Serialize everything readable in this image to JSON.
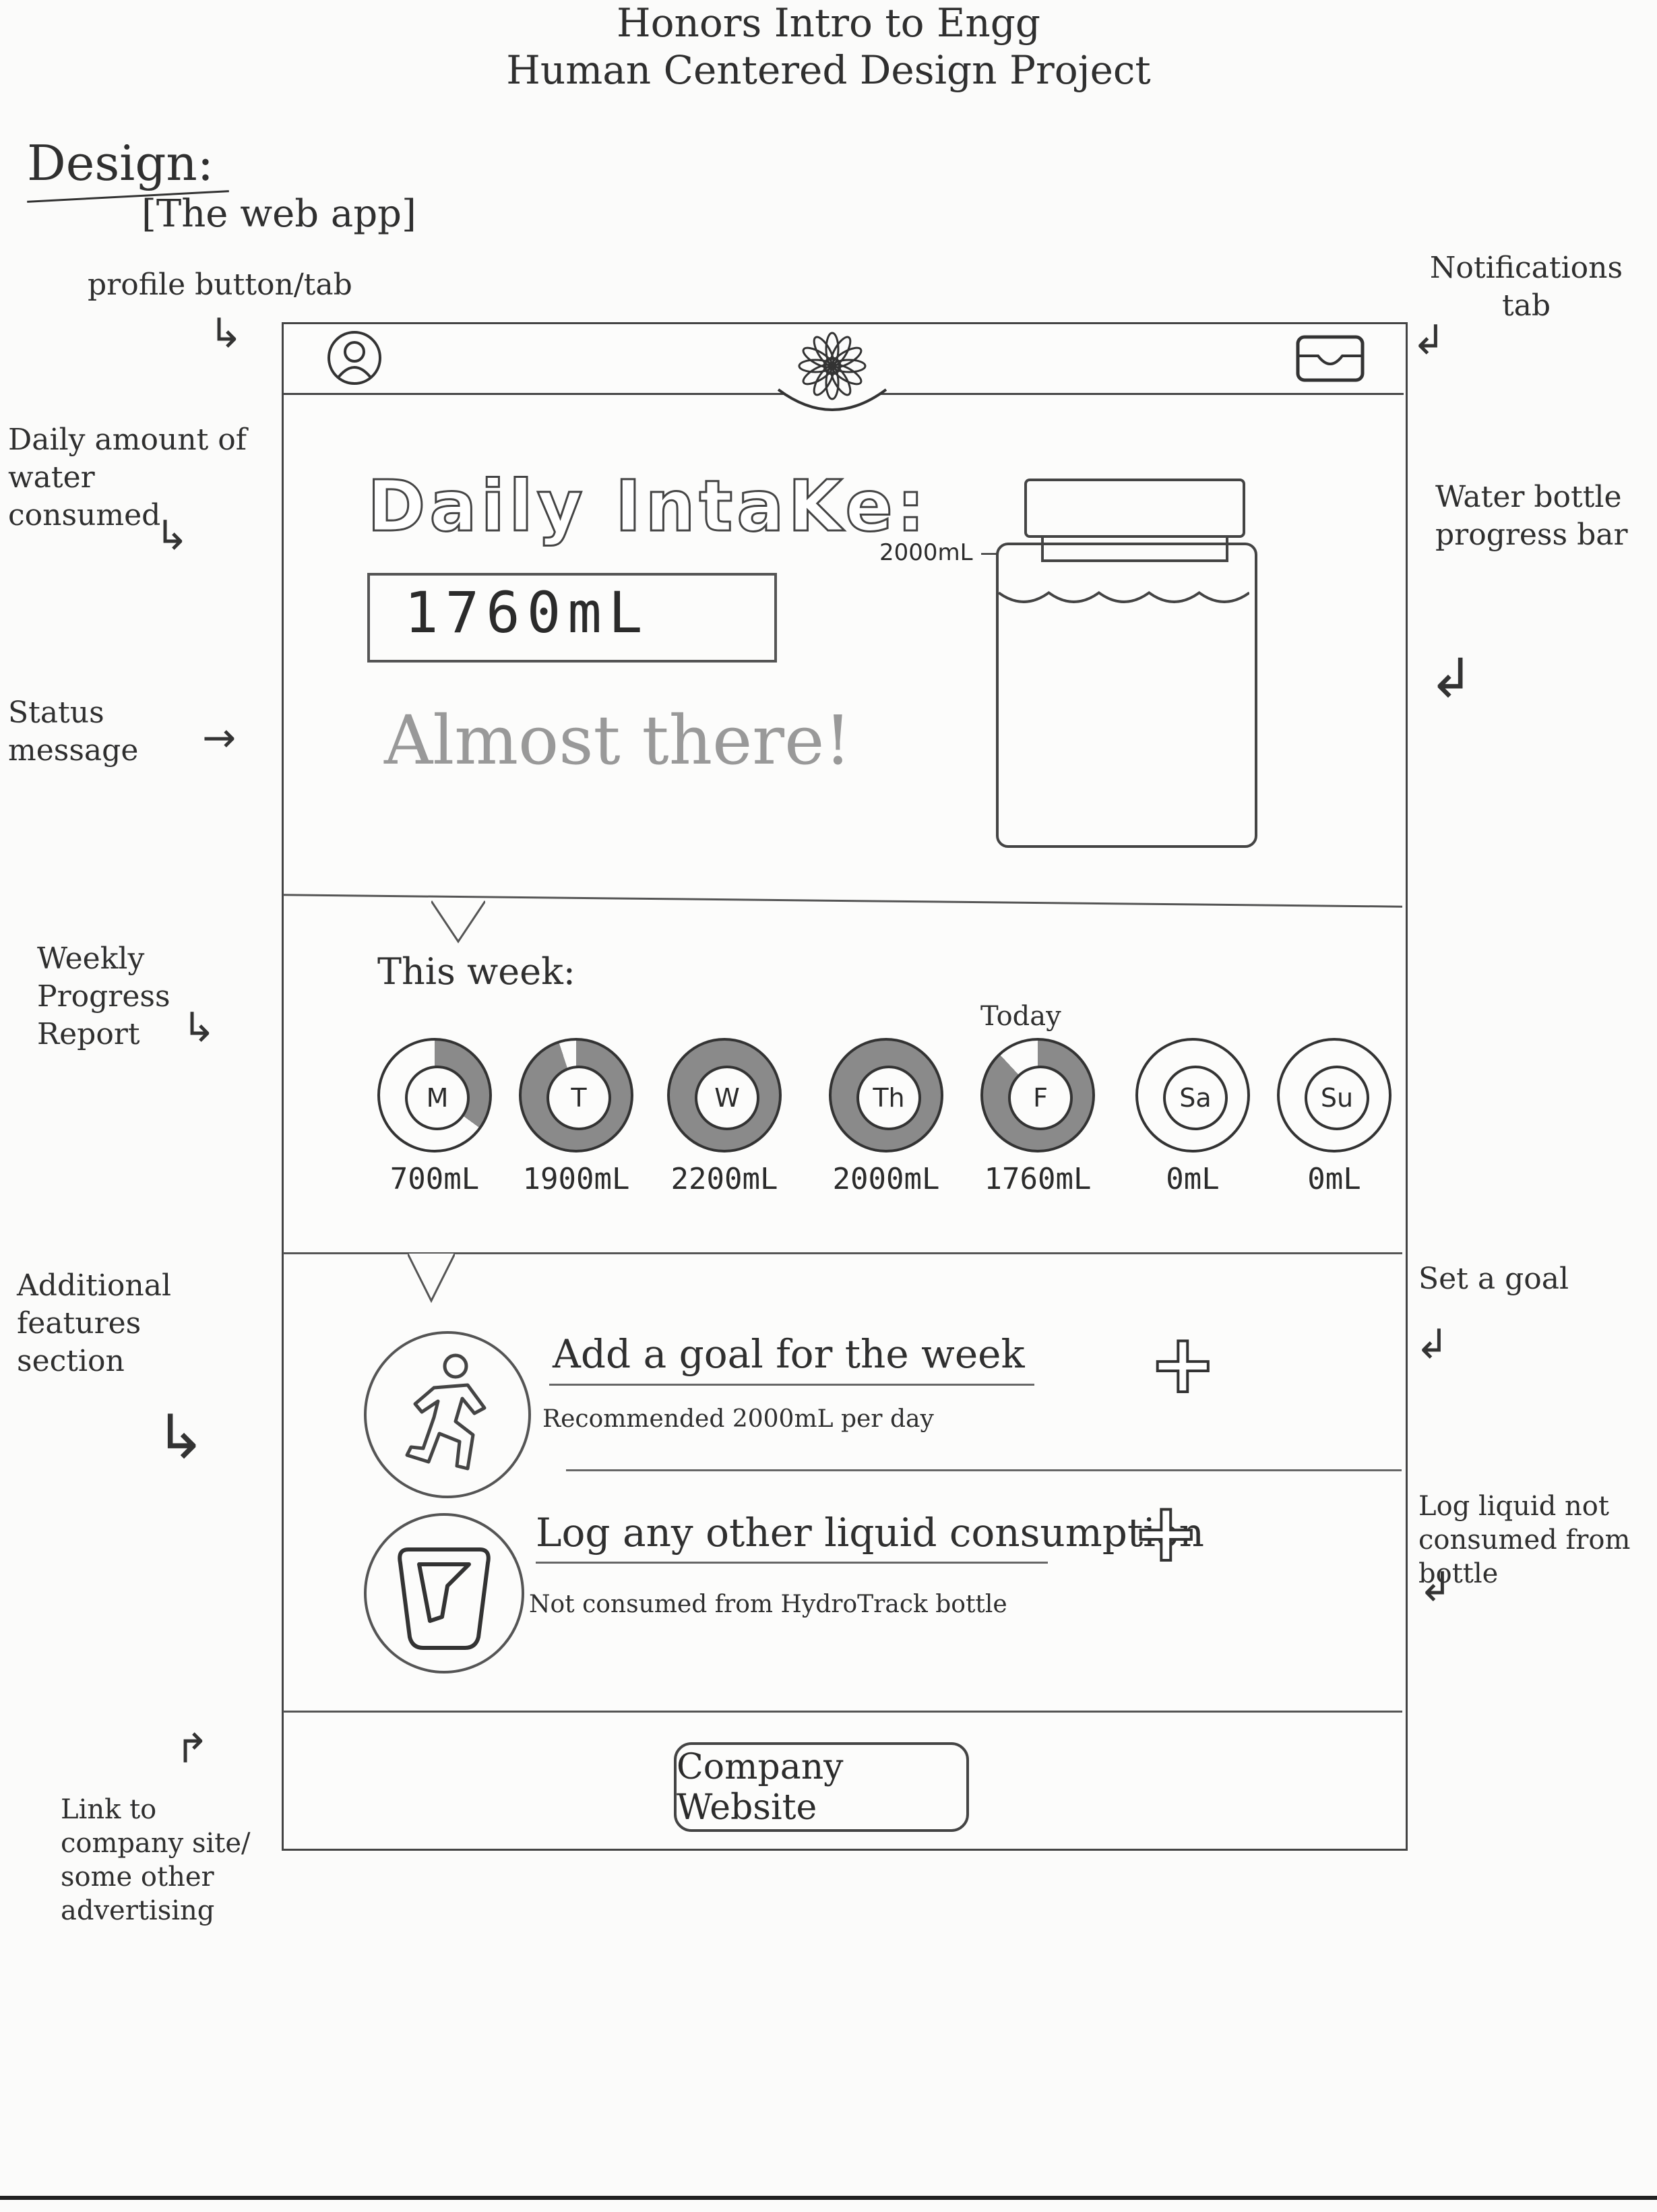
{
  "header": {
    "title_line1": "Honors Intro to Engg",
    "title_line2": "Human Centered Design Project",
    "design_label": "Design:",
    "subtitle": "[The web app]"
  },
  "annotations": {
    "profile": "profile button/tab",
    "notifications": "Notifications tab",
    "daily_amount": "Daily amount of water consumed",
    "water_bottle": "Water bottle progress bar",
    "status_message": "Status message",
    "weekly_progress": "Weekly Progress Report",
    "additional_features": "Additional features section",
    "set_goal": "Set a goal",
    "log_liquid": "Log liquid not consumed from bottle",
    "link_company": "Link to company site/ some other advertising"
  },
  "app": {
    "daily_intake_title": "Daily IntaKe:",
    "daily_intake_value": "1760mL",
    "status_message": "Almost there!",
    "bottle_marker": "2000mL",
    "bottle_fill_fraction": 0.88,
    "week_title": "This week:",
    "today_label": "Today",
    "days": [
      {
        "label": "M",
        "amount": "700mL",
        "fraction": 0.35
      },
      {
        "label": "T",
        "amount": "1900mL",
        "fraction": 0.95
      },
      {
        "label": "W",
        "amount": "2200mL",
        "fraction": 1.0
      },
      {
        "label": "Th",
        "amount": "2000mL",
        "fraction": 1.0
      },
      {
        "label": "F",
        "amount": "1760mL",
        "fraction": 0.88
      },
      {
        "label": "Sa",
        "amount": "0mL",
        "fraction": 0
      },
      {
        "label": "Su",
        "amount": "0mL",
        "fraction": 0
      }
    ],
    "goal_title": "Add a goal for the week",
    "goal_sub": "Recommended 2000mL per day",
    "log_title": "Log any other liquid consumption",
    "log_sub": "Not consumed from HydroTrack bottle",
    "company_button": "Company Website"
  },
  "icons": {
    "profile": "profile-icon",
    "logo": "flower-logo-icon",
    "notifications": "inbox-icon",
    "runner": "runner-icon",
    "cup": "cup-icon",
    "plus": "plus-icon"
  }
}
